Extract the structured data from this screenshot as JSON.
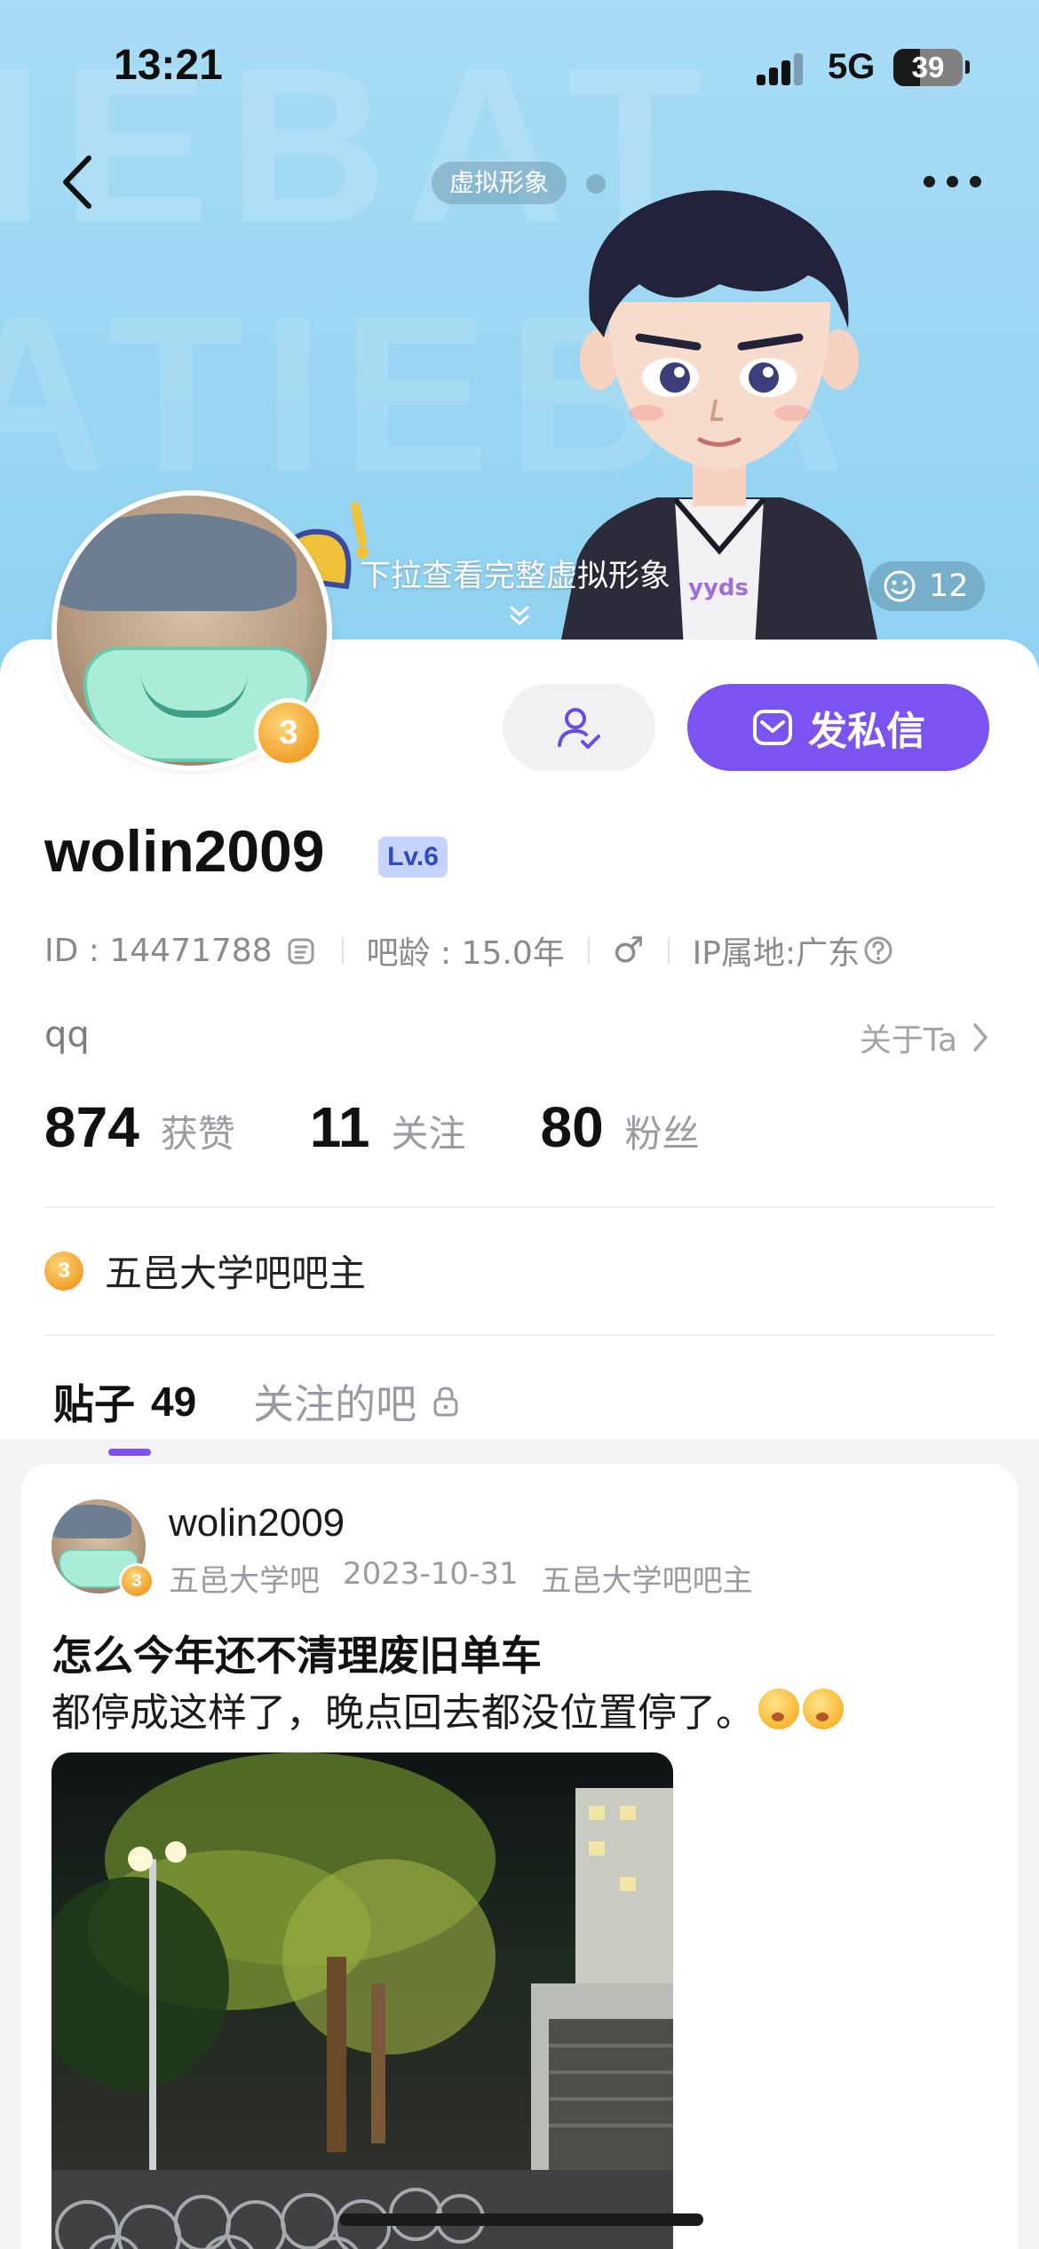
{
  "status_bar": {
    "time": "13:21",
    "network": "5G",
    "battery": "39"
  },
  "nav": {
    "avatar_chip": "虚拟形象"
  },
  "banner": {
    "pull_hint": "下拉查看完整虚拟形象",
    "like_count": "12"
  },
  "profile": {
    "username": "wolin2009",
    "level": "Lv.6",
    "id_text": "ID : 14471788",
    "bar_age": "吧龄 : 15.0年",
    "gender": "♂",
    "ip_location": "IP属地:广东",
    "bio": "qq",
    "about_link": "关于Ta",
    "message_button": "发私信",
    "honor": "五邑大学吧吧主",
    "medal_level": "3"
  },
  "stats": [
    {
      "value": "874",
      "label": "获赞"
    },
    {
      "value": "11",
      "label": "关注"
    },
    {
      "value": "80",
      "label": "粉丝"
    }
  ],
  "tabs": [
    {
      "label": "贴子",
      "count": "49"
    },
    {
      "label": "关注的吧"
    }
  ],
  "post": {
    "author": "wolin2009",
    "forum": "五邑大学吧",
    "date": "2023-10-31",
    "role": "五邑大学吧吧主",
    "title": "怎么今年还不清理废旧单车",
    "body": "都停成这样了，晚点回去都没位置停了。"
  },
  "colors": {
    "accent": "#7a53f0",
    "banner_bg": "#9ad6f3",
    "medal": "#f0a02b"
  }
}
